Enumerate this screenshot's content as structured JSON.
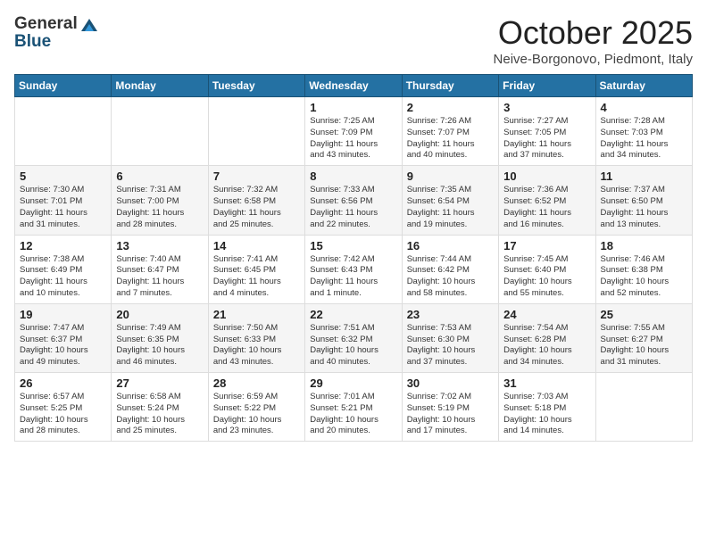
{
  "header": {
    "logo_general": "General",
    "logo_blue": "Blue",
    "month": "October 2025",
    "location": "Neive-Borgonovo, Piedmont, Italy"
  },
  "weekdays": [
    "Sunday",
    "Monday",
    "Tuesday",
    "Wednesday",
    "Thursday",
    "Friday",
    "Saturday"
  ],
  "weeks": [
    [
      {
        "day": "",
        "info": ""
      },
      {
        "day": "",
        "info": ""
      },
      {
        "day": "",
        "info": ""
      },
      {
        "day": "1",
        "info": "Sunrise: 7:25 AM\nSunset: 7:09 PM\nDaylight: 11 hours\nand 43 minutes."
      },
      {
        "day": "2",
        "info": "Sunrise: 7:26 AM\nSunset: 7:07 PM\nDaylight: 11 hours\nand 40 minutes."
      },
      {
        "day": "3",
        "info": "Sunrise: 7:27 AM\nSunset: 7:05 PM\nDaylight: 11 hours\nand 37 minutes."
      },
      {
        "day": "4",
        "info": "Sunrise: 7:28 AM\nSunset: 7:03 PM\nDaylight: 11 hours\nand 34 minutes."
      }
    ],
    [
      {
        "day": "5",
        "info": "Sunrise: 7:30 AM\nSunset: 7:01 PM\nDaylight: 11 hours\nand 31 minutes."
      },
      {
        "day": "6",
        "info": "Sunrise: 7:31 AM\nSunset: 7:00 PM\nDaylight: 11 hours\nand 28 minutes."
      },
      {
        "day": "7",
        "info": "Sunrise: 7:32 AM\nSunset: 6:58 PM\nDaylight: 11 hours\nand 25 minutes."
      },
      {
        "day": "8",
        "info": "Sunrise: 7:33 AM\nSunset: 6:56 PM\nDaylight: 11 hours\nand 22 minutes."
      },
      {
        "day": "9",
        "info": "Sunrise: 7:35 AM\nSunset: 6:54 PM\nDaylight: 11 hours\nand 19 minutes."
      },
      {
        "day": "10",
        "info": "Sunrise: 7:36 AM\nSunset: 6:52 PM\nDaylight: 11 hours\nand 16 minutes."
      },
      {
        "day": "11",
        "info": "Sunrise: 7:37 AM\nSunset: 6:50 PM\nDaylight: 11 hours\nand 13 minutes."
      }
    ],
    [
      {
        "day": "12",
        "info": "Sunrise: 7:38 AM\nSunset: 6:49 PM\nDaylight: 11 hours\nand 10 minutes."
      },
      {
        "day": "13",
        "info": "Sunrise: 7:40 AM\nSunset: 6:47 PM\nDaylight: 11 hours\nand 7 minutes."
      },
      {
        "day": "14",
        "info": "Sunrise: 7:41 AM\nSunset: 6:45 PM\nDaylight: 11 hours\nand 4 minutes."
      },
      {
        "day": "15",
        "info": "Sunrise: 7:42 AM\nSunset: 6:43 PM\nDaylight: 11 hours\nand 1 minute."
      },
      {
        "day": "16",
        "info": "Sunrise: 7:44 AM\nSunset: 6:42 PM\nDaylight: 10 hours\nand 58 minutes."
      },
      {
        "day": "17",
        "info": "Sunrise: 7:45 AM\nSunset: 6:40 PM\nDaylight: 10 hours\nand 55 minutes."
      },
      {
        "day": "18",
        "info": "Sunrise: 7:46 AM\nSunset: 6:38 PM\nDaylight: 10 hours\nand 52 minutes."
      }
    ],
    [
      {
        "day": "19",
        "info": "Sunrise: 7:47 AM\nSunset: 6:37 PM\nDaylight: 10 hours\nand 49 minutes."
      },
      {
        "day": "20",
        "info": "Sunrise: 7:49 AM\nSunset: 6:35 PM\nDaylight: 10 hours\nand 46 minutes."
      },
      {
        "day": "21",
        "info": "Sunrise: 7:50 AM\nSunset: 6:33 PM\nDaylight: 10 hours\nand 43 minutes."
      },
      {
        "day": "22",
        "info": "Sunrise: 7:51 AM\nSunset: 6:32 PM\nDaylight: 10 hours\nand 40 minutes."
      },
      {
        "day": "23",
        "info": "Sunrise: 7:53 AM\nSunset: 6:30 PM\nDaylight: 10 hours\nand 37 minutes."
      },
      {
        "day": "24",
        "info": "Sunrise: 7:54 AM\nSunset: 6:28 PM\nDaylight: 10 hours\nand 34 minutes."
      },
      {
        "day": "25",
        "info": "Sunrise: 7:55 AM\nSunset: 6:27 PM\nDaylight: 10 hours\nand 31 minutes."
      }
    ],
    [
      {
        "day": "26",
        "info": "Sunrise: 6:57 AM\nSunset: 5:25 PM\nDaylight: 10 hours\nand 28 minutes."
      },
      {
        "day": "27",
        "info": "Sunrise: 6:58 AM\nSunset: 5:24 PM\nDaylight: 10 hours\nand 25 minutes."
      },
      {
        "day": "28",
        "info": "Sunrise: 6:59 AM\nSunset: 5:22 PM\nDaylight: 10 hours\nand 23 minutes."
      },
      {
        "day": "29",
        "info": "Sunrise: 7:01 AM\nSunset: 5:21 PM\nDaylight: 10 hours\nand 20 minutes."
      },
      {
        "day": "30",
        "info": "Sunrise: 7:02 AM\nSunset: 5:19 PM\nDaylight: 10 hours\nand 17 minutes."
      },
      {
        "day": "31",
        "info": "Sunrise: 7:03 AM\nSunset: 5:18 PM\nDaylight: 10 hours\nand 14 minutes."
      },
      {
        "day": "",
        "info": ""
      }
    ]
  ]
}
